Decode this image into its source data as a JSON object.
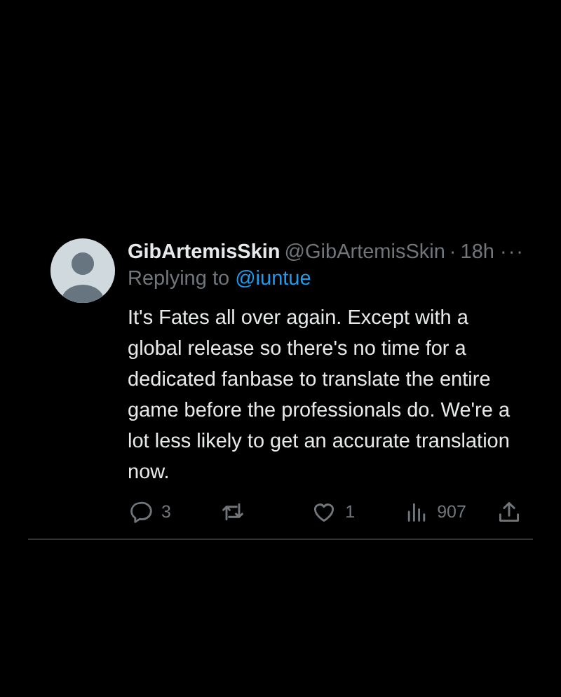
{
  "tweet": {
    "display_name": "GibArtemisSkin",
    "handle": "@GibArtemisSkin",
    "separator": "·",
    "time": "18h",
    "more": "···",
    "replying_prefix": "Replying to",
    "replying_to": "@iuntue",
    "body": "It's Fates all over again. Except with a global release so there's no time for a dedicated fanbase to translate the entire game before the professionals do. We're a lot less likely to get an accurate translation now.",
    "actions": [
      {
        "kind": "reply",
        "count": "3"
      },
      {
        "kind": "retweet"
      },
      {
        "kind": "like",
        "count": "1"
      },
      {
        "kind": "views",
        "count": "907"
      },
      {
        "kind": "share"
      }
    ]
  }
}
